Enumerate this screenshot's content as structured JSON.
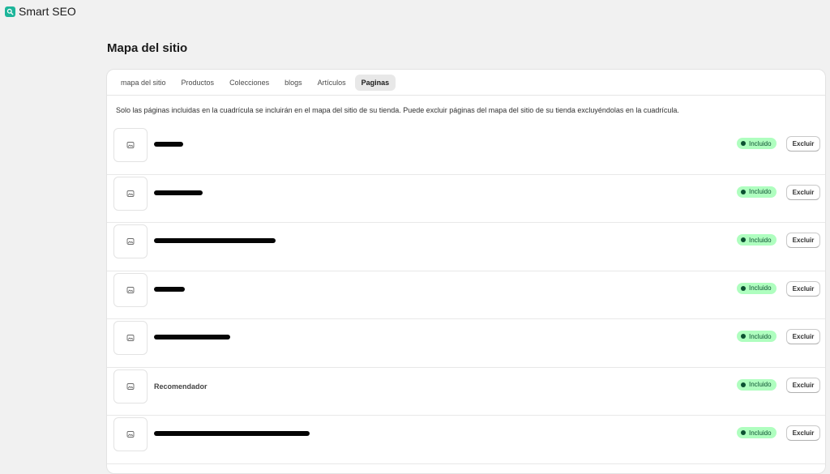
{
  "app": {
    "name": "Smart SEO",
    "logo_icon": "magnifier-icon",
    "brand_color": "#1db59a"
  },
  "page": {
    "title": "Mapa del sitio"
  },
  "tabs": [
    {
      "label": "mapa del sitio",
      "active": false
    },
    {
      "label": "Productos",
      "active": false
    },
    {
      "label": "Colecciones",
      "active": false
    },
    {
      "label": "blogs",
      "active": false
    },
    {
      "label": "Artículos",
      "active": false
    },
    {
      "label": "Paginas",
      "active": true
    }
  ],
  "description": "Solo las páginas incluidas en la cuadrícula se incluirán en el mapa del sitio de su tienda. Puede excluir páginas del mapa del sitio de su tienda excluyéndolas en la cuadrícula.",
  "rows": [
    {
      "title": "",
      "redacted": true,
      "status": "Incluido",
      "action": "Excluir"
    },
    {
      "title": "",
      "redacted": true,
      "status": "Incluido",
      "action": "Excluir"
    },
    {
      "title": "",
      "redacted": true,
      "status": "Incluido",
      "action": "Excluir"
    },
    {
      "title": "",
      "redacted": true,
      "status": "Incluido",
      "action": "Excluir"
    },
    {
      "title": "",
      "redacted": true,
      "status": "Incluido",
      "action": "Excluir"
    },
    {
      "title": "Recomendador",
      "redacted": false,
      "status": "Incluido",
      "action": "Excluir"
    },
    {
      "title": "",
      "redacted": true,
      "status": "Incluido",
      "action": "Excluir"
    }
  ],
  "status_colors": {
    "badge_bg": "#affebf",
    "badge_text": "#0c5132"
  }
}
